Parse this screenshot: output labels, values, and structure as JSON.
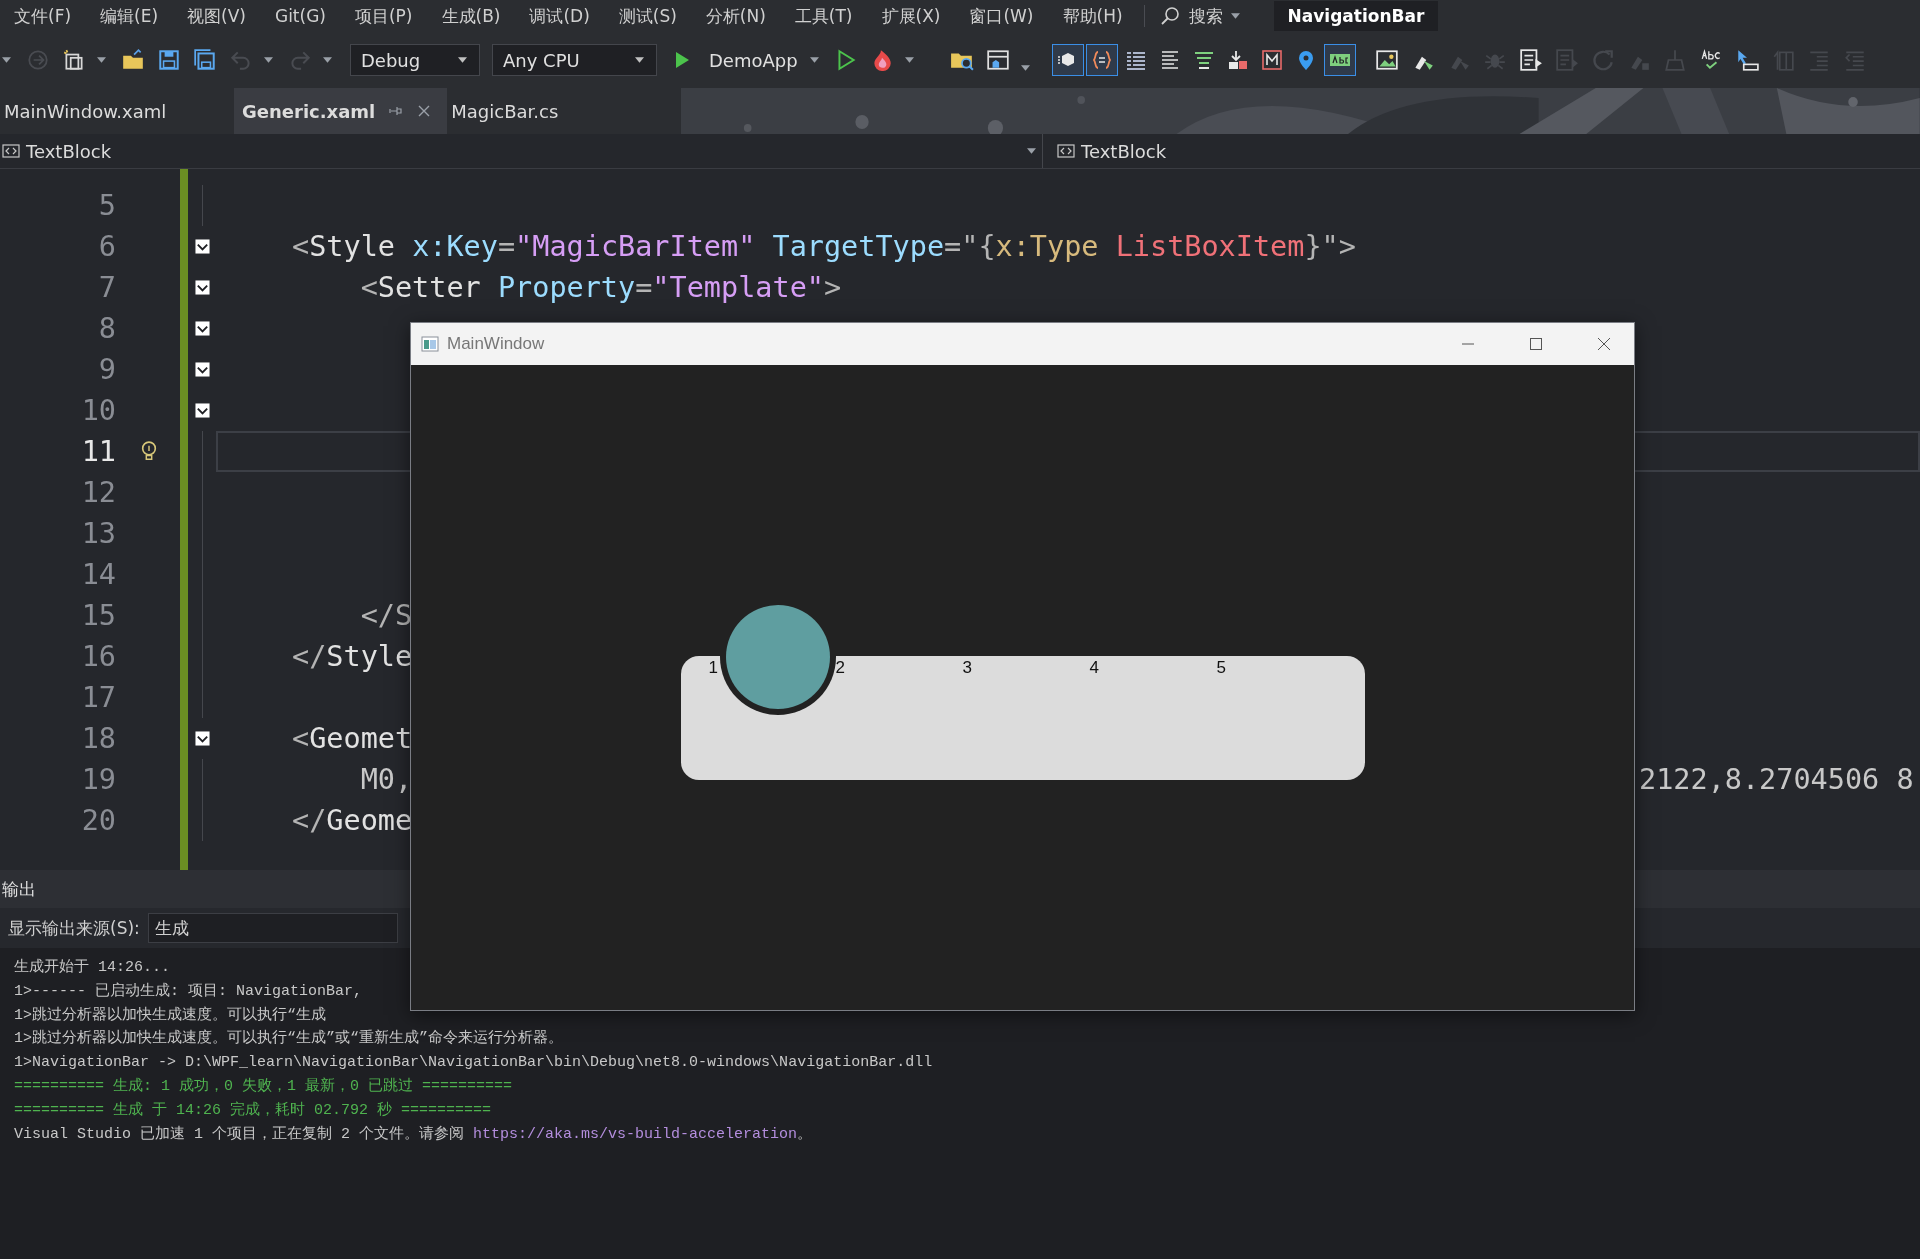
{
  "menu": {
    "items": [
      "文件(F)",
      "编辑(E)",
      "视图(V)",
      "Git(G)",
      "项目(P)",
      "生成(B)",
      "调试(D)",
      "测试(S)",
      "分析(N)",
      "工具(T)",
      "扩展(X)",
      "窗口(W)",
      "帮助(H)"
    ],
    "search": "搜索",
    "solution": "NavigationBar"
  },
  "toolbar": {
    "left": [
      {
        "disabled": true
      },
      {
        "disabled": false
      },
      {
        "disabled": false
      },
      {
        "disabled": false
      },
      {
        "disabled": false
      },
      {
        "disabled": true
      },
      {
        "disabled": true
      }
    ],
    "configuration": "Debug",
    "platform": "Any CPU",
    "start": "DemoApp",
    "toggles": [
      {
        "selected": true
      },
      {
        "selected": true
      },
      {
        "selected": false
      },
      {
        "selected": false
      },
      {
        "selected": false
      },
      {
        "selected": false
      },
      {
        "selected": false
      },
      {
        "selected": false
      },
      {
        "selected": true
      }
    ],
    "tools": [
      {
        "disabled": false
      },
      {
        "disabled": false
      },
      {
        "disabled": true
      },
      {
        "disabled": true
      },
      {
        "disabled": false
      },
      {
        "disabled": true
      },
      {
        "disabled": true
      },
      {
        "disabled": true
      },
      {
        "disabled": true
      },
      {
        "disabled": false
      },
      {
        "disabled": false
      },
      {
        "disabled": true
      },
      {
        "disabled": true
      },
      {
        "disabled": true
      }
    ]
  },
  "tabs": [
    {
      "label": "MainWindow.xaml",
      "selected": false
    },
    {
      "label": "Generic.xaml",
      "selected": true
    },
    {
      "label": "MagicBar.cs",
      "selected": false
    }
  ],
  "navigation": {
    "left": "TextBlock",
    "right": "TextBlock"
  },
  "editor": {
    "lines": [
      {
        "number": "5",
        "current": false,
        "fold": false,
        "lightbulb": false
      },
      {
        "number": "6",
        "current": false,
        "fold": true,
        "lightbulb": false,
        "code": [
          {
            "text": "<",
            "kind": "punct"
          },
          {
            "text": "Style",
            "kind": "element"
          },
          {
            "text": " x:Key",
            "kind": "attr"
          },
          {
            "text": "=",
            "kind": "punct"
          },
          {
            "text": "\"MagicBarItem\"",
            "kind": "value"
          },
          {
            "text": " TargetType",
            "kind": "attr"
          },
          {
            "text": "=\"{",
            "kind": "punct"
          },
          {
            "text": "x:Type",
            "kind": "markup"
          },
          {
            "text": " ListBoxItem",
            "kind": "type"
          },
          {
            "text": "}\">",
            "kind": "punct"
          }
        ]
      },
      {
        "number": "7",
        "current": false,
        "fold": true,
        "lightbulb": false,
        "code": [
          {
            "text": "    <",
            "kind": "punct"
          },
          {
            "text": "Setter",
            "kind": "element"
          },
          {
            "text": " Property",
            "kind": "attr"
          },
          {
            "text": "=",
            "kind": "punct"
          },
          {
            "text": "\"Template\"",
            "kind": "value"
          },
          {
            "text": ">",
            "kind": "punct"
          }
        ]
      },
      {
        "number": "8",
        "current": false,
        "fold": true,
        "lightbulb": false
      },
      {
        "number": "9",
        "current": false,
        "fold": true,
        "lightbulb": false
      },
      {
        "number": "10",
        "current": false,
        "fold": true,
        "lightbulb": false
      },
      {
        "number": "11",
        "current": true,
        "fold": false,
        "lightbulb": true
      },
      {
        "number": "12",
        "current": false,
        "fold": false,
        "lightbulb": false
      },
      {
        "number": "13",
        "current": false,
        "fold": false,
        "lightbulb": false
      },
      {
        "number": "14",
        "current": false,
        "fold": false,
        "lightbulb": false
      },
      {
        "number": "15",
        "current": false,
        "fold": false,
        "lightbulb": false,
        "code": [
          {
            "text": "    </S",
            "kind": "punct"
          }
        ]
      },
      {
        "number": "16",
        "current": false,
        "fold": false,
        "lightbulb": false,
        "code": [
          {
            "text": "</",
            "kind": "punct"
          },
          {
            "text": "Style",
            "kind": "element"
          }
        ]
      },
      {
        "number": "17",
        "current": false,
        "fold": false,
        "lightbulb": false
      },
      {
        "number": "18",
        "current": false,
        "fold": true,
        "lightbulb": false,
        "code": [
          {
            "text": "<",
            "kind": "punct"
          },
          {
            "text": "Geomet",
            "kind": "element"
          }
        ]
      },
      {
        "number": "19",
        "current": false,
        "fold": false,
        "lightbulb": false,
        "code": [
          {
            "text": "    M0,",
            "kind": "text"
          }
        ],
        "right": [
          {
            "text": "2122,8.2704506 8",
            "kind": "text"
          }
        ]
      },
      {
        "number": "20",
        "current": false,
        "fold": false,
        "lightbulb": false,
        "code": [
          {
            "text": "</",
            "kind": "punct"
          },
          {
            "text": "Geome",
            "kind": "element"
          }
        ]
      }
    ]
  },
  "output": {
    "title": "输出",
    "source_label": "显示输出来源(S):",
    "source": "生成",
    "lines": [
      {
        "text": "生成开始于 14:26...",
        "kind": "normal"
      },
      {
        "text": "1>------ 已启动生成: 项目: NavigationBar,",
        "kind": "normal"
      },
      {
        "text": "1>跳过分析器以加快生成速度。可以执行“生成",
        "kind": "normal"
      },
      {
        "text": "1>跳过分析器以加快生成速度。可以执行“生成”或“重新生成”命令来运行分析器。",
        "kind": "normal"
      },
      {
        "text": "1>NavigationBar -> D:\\WPF_learn\\NavigationBar\\NavigationBar\\bin\\Debug\\net8.0-windows\\NavigationBar.dll",
        "kind": "normal"
      },
      {
        "text": "========== 生成: 1 成功，0 失败，1 最新，0 已跳过 ==========",
        "kind": "success"
      },
      {
        "text": "========== 生成 于 14:26 完成，耗时 02.792 秒 ==========",
        "kind": "success"
      },
      {
        "text": "Visual Studio 已加速 1 个项目，正在复制 2 个文件。请参阅 ",
        "kind": "normal",
        "link": "https://aka.ms/vs-build-acceleration",
        "after": "。"
      }
    ]
  },
  "app_window": {
    "title": "MainWindow",
    "items": [
      {
        "label": "1",
        "selected": true
      },
      {
        "label": "2",
        "selected": false
      },
      {
        "label": "3",
        "selected": false
      },
      {
        "label": "4",
        "selected": false
      },
      {
        "label": "5",
        "selected": false
      }
    ]
  }
}
